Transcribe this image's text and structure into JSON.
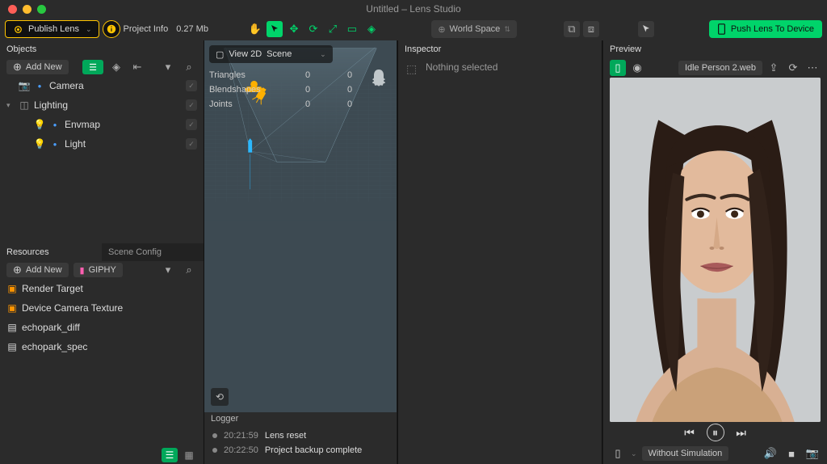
{
  "window": {
    "title": "Untitled – Lens Studio"
  },
  "toolbar": {
    "publish": "Publish Lens",
    "project_info": "Project Info",
    "size": "0.27 Mb",
    "worldspace": "World Space",
    "push": "Push Lens To Device"
  },
  "objects": {
    "title": "Objects",
    "add_new": "Add New",
    "items": [
      {
        "icon": "cam",
        "label": "Camera",
        "checked": true,
        "level": 0,
        "arrow": ""
      },
      {
        "icon": "grp",
        "label": "Lighting",
        "checked": true,
        "level": 0,
        "arrow": "▾"
      },
      {
        "icon": "light",
        "label": "Envmap",
        "checked": true,
        "level": 1,
        "arrow": ""
      },
      {
        "icon": "light",
        "label": "Light",
        "checked": true,
        "level": 1,
        "arrow": ""
      }
    ]
  },
  "resources": {
    "tabs": [
      "Resources",
      "Scene Config"
    ],
    "active": 0,
    "add_new": "Add New",
    "giphy": "GIPHY",
    "items": [
      {
        "icon": "orange",
        "label": "Render Target"
      },
      {
        "icon": "orange",
        "label": "Device Camera Texture"
      },
      {
        "icon": "file",
        "label": "echopark_diff"
      },
      {
        "icon": "file",
        "label": "echopark_spec"
      }
    ]
  },
  "viewport": {
    "switcher_label": "View 2D",
    "switcher_field": "Scene",
    "stats": [
      {
        "label": "Triangles",
        "a": "0",
        "b": "0"
      },
      {
        "label": "Blendshapes",
        "a": "0",
        "b": "0"
      },
      {
        "label": "Joints",
        "a": "0",
        "b": "0"
      }
    ]
  },
  "logger": {
    "title": "Logger",
    "lines": [
      {
        "time": "20:21:59",
        "msg": "Lens reset"
      },
      {
        "time": "20:22:50",
        "msg": "Project backup complete"
      }
    ]
  },
  "inspector": {
    "title": "Inspector",
    "nothing": "Nothing selected"
  },
  "preview": {
    "title": "Preview",
    "source": "Idle Person 2.web",
    "sim": "Without Simulation"
  }
}
